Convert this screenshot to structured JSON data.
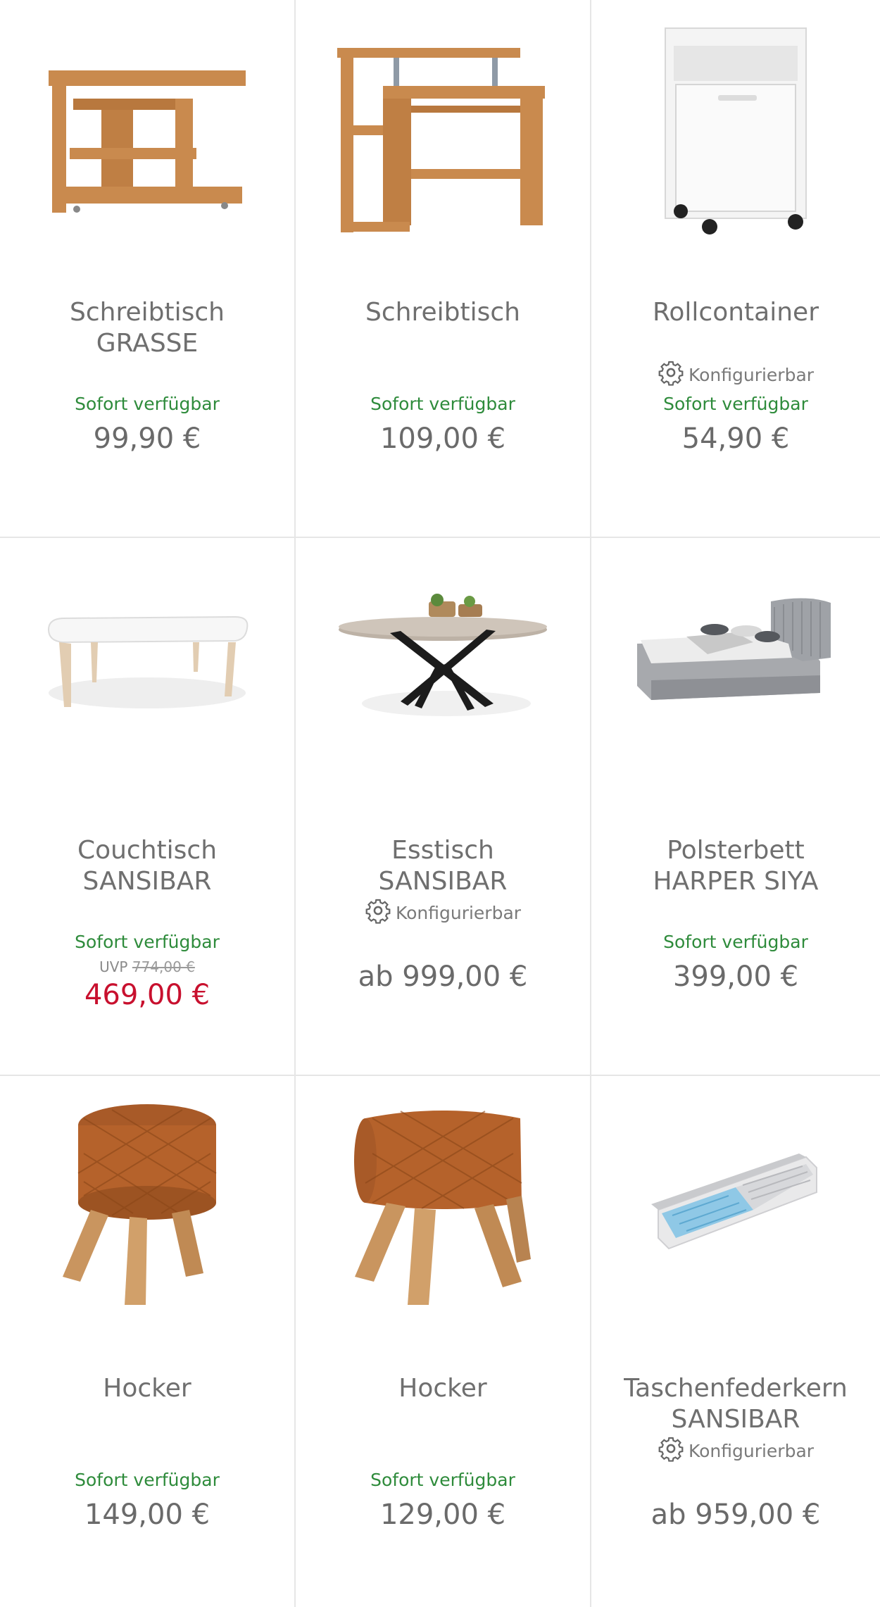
{
  "products": [
    {
      "title": "Schreibtisch\nGRASSE",
      "configurable": "",
      "availability": "Sofort verfügbar",
      "uvp_label": "",
      "uvp_price": "",
      "price": "99,90 €"
    },
    {
      "title": "Schreibtisch",
      "configurable": "",
      "availability": "Sofort verfügbar",
      "uvp_label": "",
      "uvp_price": "",
      "price": "109,00 €"
    },
    {
      "title": "Rollcontainer",
      "configurable": "Konfigurierbar",
      "availability": "Sofort verfügbar",
      "uvp_label": "",
      "uvp_price": "",
      "price": "54,90 €"
    },
    {
      "title": "Couchtisch\nSANSIBAR",
      "configurable": "",
      "availability": "Sofort verfügbar",
      "uvp_label": "UVP",
      "uvp_price": "774,00 €",
      "price": "469,00 €"
    },
    {
      "title": "Esstisch\nSANSIBAR",
      "configurable": "Konfigurierbar",
      "availability": "",
      "uvp_label": "",
      "uvp_price": "",
      "price": "ab 999,00 €"
    },
    {
      "title": "Polsterbett\nHARPER SIYA",
      "configurable": "",
      "availability": "Sofort verfügbar",
      "uvp_label": "",
      "uvp_price": "",
      "price": "399,00 €"
    },
    {
      "title": "Hocker",
      "configurable": "",
      "availability": "Sofort verfügbar",
      "uvp_label": "",
      "uvp_price": "",
      "price": "149,00 €"
    },
    {
      "title": "Hocker",
      "configurable": "",
      "availability": "Sofort verfügbar",
      "uvp_label": "",
      "uvp_price": "",
      "price": "129,00 €"
    },
    {
      "title": "Taschenfederkern\nSANSIBAR",
      "configurable": "Konfigurierbar",
      "availability": "",
      "uvp_label": "",
      "uvp_price": "",
      "price": "ab 959,00 €"
    }
  ],
  "colors": {
    "availability": "#2e8b3b",
    "sale_price": "#c8102e",
    "price": "#6a6a6a",
    "divider": "#e6e6e6"
  },
  "icons": {
    "configurable": "gear-icon"
  }
}
